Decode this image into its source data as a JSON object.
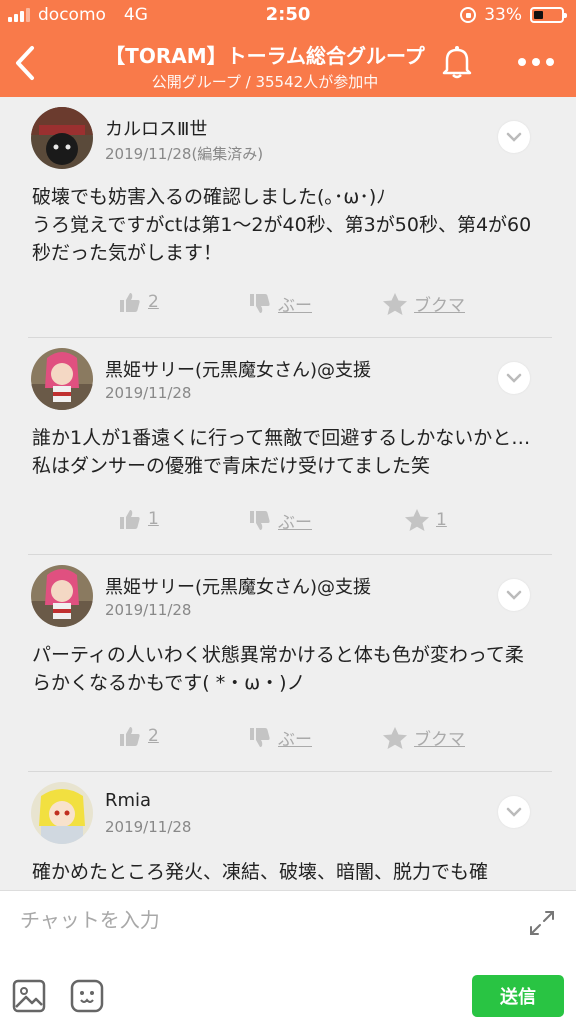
{
  "status": {
    "carrier": "docomo",
    "network": "4G",
    "time": "2:50",
    "battery": "33%"
  },
  "header": {
    "title": "【TORAM】トーラム総合グループ",
    "subtitle": "公開グループ / 35542人が参加中"
  },
  "posts": [
    {
      "author": "カルロスⅢ世",
      "date": "2019/11/28(編集済み)",
      "text": "破壊でも妨害入るの確認しました(｡･ω･)ﾉ\nうろ覚えですがctは第1〜2が40秒、第3が50秒、第4が60秒だった気がします！",
      "like": "2",
      "dislike": "ぶー",
      "bookmark": "ブクマ"
    },
    {
      "author": "黒姫サリー(元黒魔女さん)@支援",
      "date": "2019/11/28",
      "text": "誰か1人が1番遠くに行って無敵で回避するしかないかと…私はダンサーの優雅で青床だけ受けてました笑",
      "like": "1",
      "dislike": "ぶー",
      "bookmark": "1"
    },
    {
      "author": "黒姫サリー(元黒魔女さん)@支援",
      "date": "2019/11/28",
      "text": "パーティの人いわく状態異常かけると体も色が変わって柔らかくなるかもです( *・ω・)ノ",
      "like": "2",
      "dislike": "ぶー",
      "bookmark": "ブクマ"
    },
    {
      "author": "Rmia",
      "date": "2019/11/28",
      "text": "確かめたところ発火、凍結、破壊、暗闇、脱力でも確"
    }
  ],
  "composer": {
    "placeholder": "チャットを入力",
    "send_label": "送信"
  },
  "colors": {
    "accent": "#f97a4a",
    "send": "#29c443"
  }
}
